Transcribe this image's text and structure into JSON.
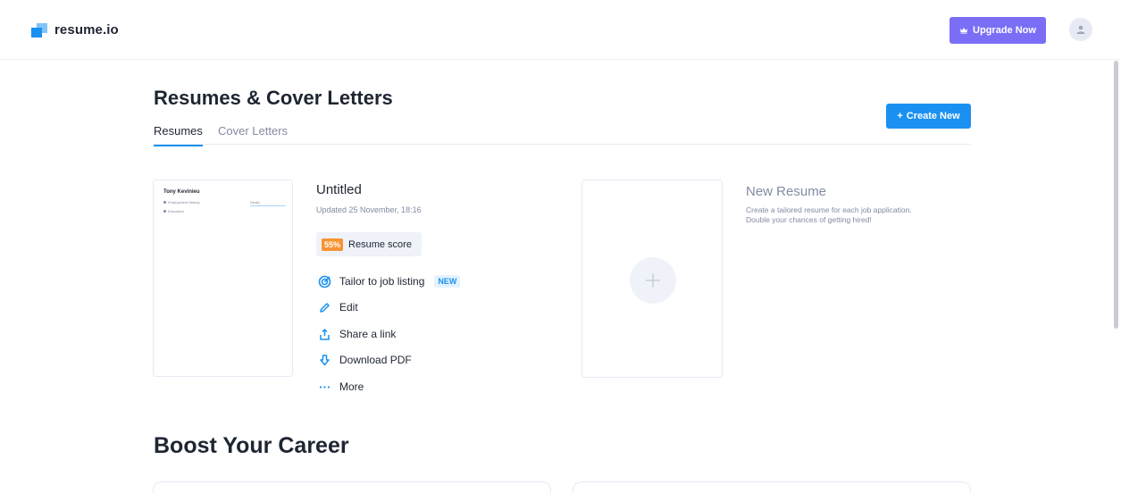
{
  "header": {
    "logo_text": "resume.io",
    "upgrade_label": "Upgrade Now"
  },
  "page": {
    "title": "Resumes & Cover Letters",
    "create_label": "Create New",
    "tabs": [
      {
        "label": "Resumes",
        "active": true
      },
      {
        "label": "Cover Letters",
        "active": false
      }
    ]
  },
  "resume": {
    "preview_name": "Tony Kevinieu",
    "preview_sections": [
      "Employment History",
      "Education"
    ],
    "preview_detail": "Details",
    "title": "Untitled",
    "updated": "Updated 25 November, 18:16",
    "score_pct": "55%",
    "score_label": "Resume score",
    "actions": [
      {
        "label": "Tailor to job listing",
        "icon": "target-icon",
        "badge": "NEW"
      },
      {
        "label": "Edit",
        "icon": "pencil-icon"
      },
      {
        "label": "Share a link",
        "icon": "share-icon"
      },
      {
        "label": "Download PDF",
        "icon": "download-icon"
      },
      {
        "label": "More",
        "icon": "more-icon"
      }
    ]
  },
  "new_resume": {
    "title": "New Resume",
    "description": "Create a tailored resume for each job application. Double your chances of getting hired!"
  },
  "boost": {
    "title": "Boost Your Career"
  },
  "colors": {
    "brand": "#1a91f0",
    "upgrade": "#7a6ef6",
    "score": "#f79433"
  }
}
